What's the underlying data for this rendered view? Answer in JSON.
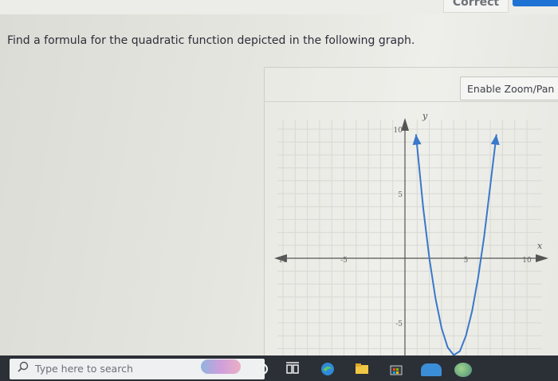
{
  "header": {
    "status_label": "Correct"
  },
  "question": {
    "text": "Find a formula for the quadratic function depicted in the following graph."
  },
  "graph_panel": {
    "zoom_button_label": "Enable Zoom/Pan",
    "x_axis_label": "x",
    "y_axis_label": "y",
    "x_ticks": [
      "10",
      "-5",
      "5",
      "10"
    ],
    "y_ticks": [
      "10",
      "5",
      "-5"
    ]
  },
  "taskbar": {
    "search_placeholder": "Type here to search",
    "icons": [
      "search-icon",
      "cortana-icon",
      "task-view-icon",
      "edge-icon",
      "file-explorer-icon",
      "store-icon"
    ]
  },
  "chart_data": {
    "type": "line",
    "title": "",
    "xlabel": "x",
    "ylabel": "y",
    "xlim": [
      -10,
      10
    ],
    "ylim": [
      -10,
      10
    ],
    "grid": true,
    "series": [
      {
        "x": [
          0.9,
          1.5,
          2,
          2.5,
          3,
          3.5,
          4,
          4.5,
          5,
          5.5,
          6,
          6.5,
          7.5
        ],
        "values": [
          9.6,
          3.9,
          0,
          -3.1,
          -5.4,
          -6.9,
          -7.5,
          -7.2,
          -6.0,
          -4.1,
          -1.5,
          1.7,
          9.6
        ]
      }
    ]
  }
}
